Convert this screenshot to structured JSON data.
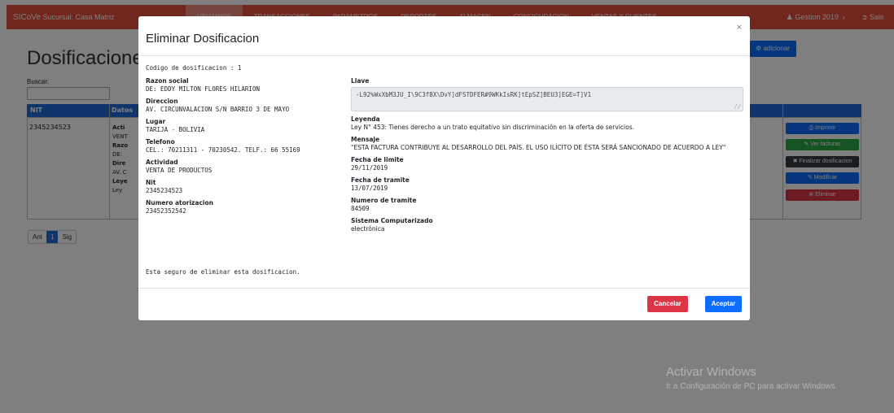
{
  "navbar": {
    "brand": "SICoVe",
    "branch": "Sucursal: Casa Matriz",
    "items": [
      "USUARIOS",
      "TRANSACCIONES",
      "PARAMETROS",
      "REPORTES",
      "ALMACEN",
      "CONFIGURACION",
      "VENTAS Y CLIENTES"
    ],
    "gestion": "Gestion 2019",
    "salir": "Salir"
  },
  "page": {
    "title": "Dosificaciones",
    "add_button": "adicionar",
    "search_label": "Buscar:",
    "columns": [
      "NIT",
      "Datos"
    ],
    "row": {
      "nit": "2345234523",
      "lines": [
        {
          "k": "Acti",
          "v": "VENT"
        },
        {
          "k": "Razo",
          "v": "DE:"
        },
        {
          "k": "Dire",
          "v": "AV. C"
        },
        {
          "k": "Leye",
          "v": "Ley"
        }
      ]
    },
    "actions": {
      "imprimir": "Imprimir",
      "ver_facturas": "Ver facturas",
      "finalizar": "Finalizar dosificacion",
      "modificar": "Modificar",
      "eliminar": "Eliminar"
    },
    "pager": {
      "prev": "Ant",
      "current": "1",
      "next": "Sig"
    }
  },
  "watermark": {
    "line1": "Activar Windows",
    "line2": "Ir a Configuración de PC para activar Windows."
  },
  "modal": {
    "title": "Eliminar Dosificacion",
    "close": "×",
    "codigo": "Codigo de dosificacion : 1",
    "left": [
      {
        "label": "Razon social",
        "value": "DE: EDDY MILTON FLORES HILARION"
      },
      {
        "label": "Direccion",
        "value": "AV. CIRCUNVALACION S/N BARRIO 3 DE MAYO"
      },
      {
        "label": "Lugar",
        "value": "TARIJA - BOLIVIA"
      },
      {
        "label": "Telefono",
        "value": "CEL.: 70211311 - 70230542. TELF.: 66 55169"
      },
      {
        "label": "Actividad",
        "value": "VENTA DE PRODUCTOS"
      },
      {
        "label": "Nit",
        "value": "2345234523"
      },
      {
        "label": "Numero atorizacion",
        "value": "23452352542"
      }
    ],
    "llave_label": "Llave",
    "llave_value": "-L92%WxXbM3JU_I\\9C3f8X\\DvY]dFSTDFER#9WKkIsRK]tEpSZ]BEU3]EGE=T]V1",
    "right": [
      {
        "label": "Leyenda",
        "value": "Ley N° 453: Tienes derecho a un trato equitativo sin discriminación en la oferta de servicios."
      },
      {
        "label": "Mensaje",
        "value": "\"ESTA FACTURA CONTRIBUYE AL DESARROLLO DEL PAÍS. EL USO ILÍCITO DE ÉSTA SERÁ SANCIONADO DE ACUERDO A LEY\""
      },
      {
        "label": "Fecha de limite",
        "value": "29/11/2019"
      },
      {
        "label": "Fecha de tramite",
        "value": "13/07/2019"
      },
      {
        "label": "Numero de tramite",
        "value": "84509"
      },
      {
        "label": "Sistema Computarizado",
        "value": "electrónica"
      }
    ],
    "confirm_text": "Esta seguro de eliminar esta dosificacion.",
    "cancel": "Cancelar",
    "accept": "Aceptar"
  },
  "colors": {
    "navbar": "#e24c3d",
    "primary": "#0d6efd",
    "danger": "#dc3545",
    "success": "#28a745",
    "dark": "#343a40",
    "table_header": "#1e6ad6"
  }
}
